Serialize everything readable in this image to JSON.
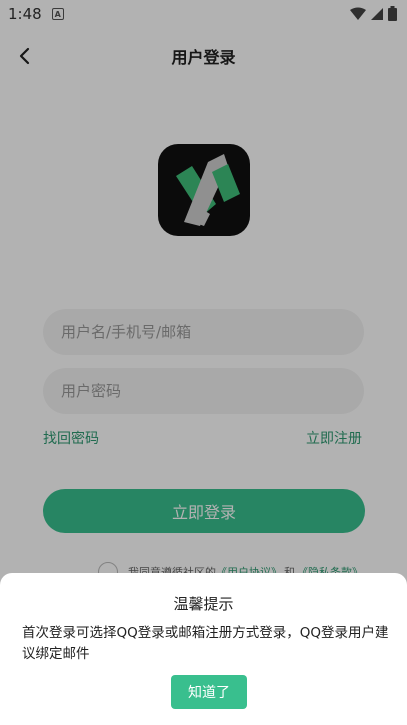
{
  "status_bar": {
    "time": "1:48",
    "notification_letter": "A",
    "icons": [
      "wifi-icon",
      "signal-icon",
      "battery-icon"
    ]
  },
  "header": {
    "title": "用户登录",
    "back_icon": "chevron-left-icon"
  },
  "form": {
    "username_placeholder": "用户名/手机号/邮箱",
    "password_placeholder": "用户密码",
    "forgot_label": "找回密码",
    "register_label": "立即注册",
    "login_label": "立即登录"
  },
  "agreement": {
    "prefix": "我同意遵循社区的",
    "user_agreement": "《用户协议》",
    "conjunction": "和",
    "privacy": "《隐私条款》"
  },
  "dialog": {
    "title": "温馨提示",
    "message": "首次登录可选择QQ登录或邮箱注册方式登录，QQ登录用户建议绑定邮件",
    "confirm_label": "知道了"
  },
  "colors": {
    "accent": "#39bf8e",
    "link": "#2e9a72",
    "overlay": "rgba(0,0,0,0.30)"
  }
}
